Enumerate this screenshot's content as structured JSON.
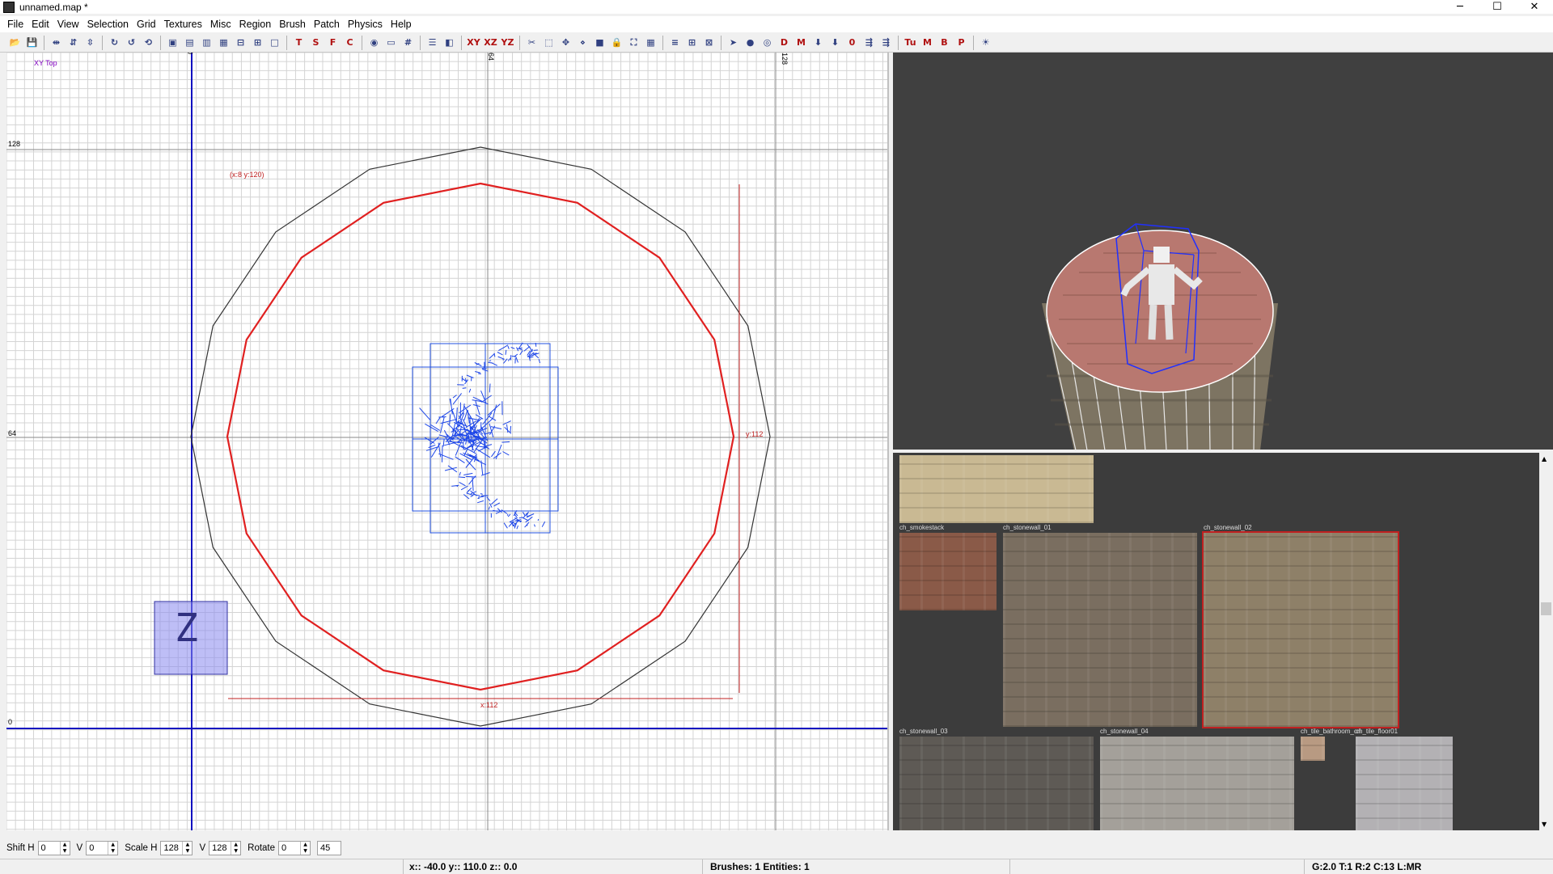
{
  "window": {
    "title": "unnamed.map *",
    "minimize": "─",
    "maximize": "☐",
    "close": "✕"
  },
  "menu": [
    "File",
    "Edit",
    "View",
    "Selection",
    "Grid",
    "Textures",
    "Misc",
    "Region",
    "Brush",
    "Patch",
    "Physics",
    "Help"
  ],
  "toolbar_icons": [
    "open-icon",
    "save-icon",
    "sep",
    "flip-x-icon",
    "flip-y-icon",
    "flip-z-icon",
    "sep",
    "rotate-x-icon",
    "rotate-y-icon",
    "rotate-z-icon",
    "sep",
    "select-complete-icon",
    "select-touching-icon",
    "select-partial-icon",
    "select-inside-icon",
    "csg-subtract-icon",
    "csg-merge-icon",
    "hollow-icon",
    "sep",
    "texture-lock-icon",
    "scale-lock-icon",
    "texture-fit-icon",
    "cycle-layer-icon",
    "sep",
    "camera-icon",
    "view-change-icon",
    "grid-icon",
    "sep",
    "entities-icon",
    "show-icon",
    "sep",
    "view-xy-icon",
    "view-xz-icon",
    "view-yz-icon",
    "sep",
    "clipper-icon",
    "select-icon",
    "drag-icon",
    "vertex-icon",
    "cube-icon",
    "lock-icon",
    "camera-move-icon",
    "overlay-icon",
    "sep",
    "patch-bend-icon",
    "patch-insert-icon",
    "patch-delete-icon",
    "sep",
    "pointer-icon",
    "red-circle-icon",
    "red-circle-2-icon",
    "d-icon",
    "m-icon",
    "down-icon",
    "down-2-icon",
    "zero-icon",
    "path-icon",
    "path-2-icon",
    "sep",
    "tu-icon",
    "m2-icon",
    "b-icon",
    "p-icon",
    "sep",
    "light-icon"
  ],
  "toolbar_glyphs": [
    "📂",
    "💾",
    "|",
    "⇹",
    "⇵",
    "⇳",
    "|",
    "↻",
    "↺",
    "⟲",
    "|",
    "▣",
    "▤",
    "▥",
    "▦",
    "⊟",
    "⊞",
    "□",
    "|",
    "T",
    "S",
    "F",
    "C",
    "|",
    "◉",
    "▭",
    "#",
    "|",
    "☰",
    "◧",
    "|",
    "XY",
    "XZ",
    "YZ",
    "|",
    "✂",
    "⬚",
    "✥",
    "⋄",
    "■",
    "🔒",
    "⛶",
    "▦",
    "|",
    "≡",
    "⊞",
    "⊠",
    "|",
    "➤",
    "●",
    "◎",
    "D",
    "M",
    "⬇",
    "⬇",
    "0",
    "⇶",
    "⇶",
    "|",
    "Tu",
    "M",
    "B",
    "P",
    "|",
    "☀"
  ],
  "view2d": {
    "label": "XY Top",
    "ruler_top": [
      "0",
      "64",
      "128"
    ],
    "ruler_left": [
      "128",
      "64",
      "0"
    ],
    "dim_corner": "(x:8  y:120)",
    "dim_x": "x:112",
    "dim_y": "y:112",
    "z_marker": "Z"
  },
  "textures": {
    "items": [
      {
        "name": "",
        "color": "#c9b993"
      },
      {
        "name": "ch_smokestack",
        "color": "#8a5a48"
      },
      {
        "name": "ch_stonewall_01",
        "color": "#7a6e60"
      },
      {
        "name": "ch_stonewall_02",
        "color": "#8e8068"
      },
      {
        "name": "ch_stonewall_03",
        "color": "#5e5a55"
      },
      {
        "name": "ch_stonewall_04",
        "color": "#a4a09a"
      },
      {
        "name": "ch_tile_bathroom_cri",
        "color": "#b89a82"
      },
      {
        "name": "ch_tile_floor01",
        "color": "#b3b1b4"
      }
    ]
  },
  "bottom": {
    "shift_h_label": "Shift H",
    "shift_h": "0",
    "shift_v_label": "V",
    "shift_v": "0",
    "scale_h_label": "Scale H",
    "scale_h": "128",
    "scale_v_label": "V",
    "scale_v": "128",
    "rotate_label": "Rotate",
    "rotate": "0",
    "rotate_step": "45"
  },
  "status": {
    "coords": "x:: -40.0  y:: 110.0  z:: 0.0",
    "counts": "Brushes: 1 Entities: 1",
    "grid": "G:2.0 T:1 R:2 C:13 L:MR"
  }
}
